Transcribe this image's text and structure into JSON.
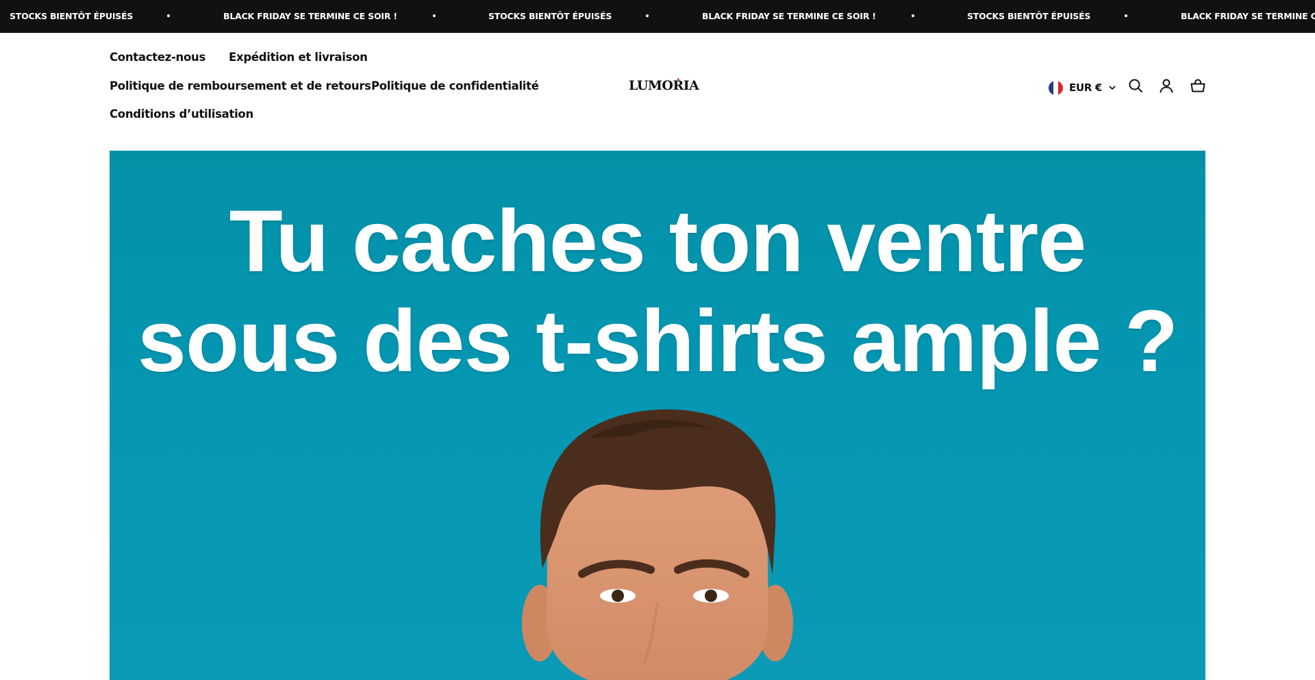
{
  "announcement": {
    "items": [
      "STOCKS BIENTÔT ÉPUISÉS",
      "BLACK FRIDAY SE TERMINE CE SOIR !",
      "STOCKS BIENTÔT ÉPUISÉS",
      "BLACK FRIDAY SE TERMINE CE SOIR !",
      "STOCKS BIENTÔT ÉPUISÉS",
      "BLACK FRIDAY SE TERMINE CE SOIR !"
    ],
    "background": "#111111",
    "text_color": "#ffffff"
  },
  "nav": {
    "contact": "Contactez-nous",
    "shipping": "Expédition et livraison",
    "refunds": "Politique de remboursement et de retours",
    "privacy": "Politique de confidentialité",
    "terms": "Conditions d’utilisation"
  },
  "brand": {
    "logo_text": "LUMORIA",
    "accent": "#c0392b"
  },
  "utility": {
    "currency": "EUR €",
    "flag_colors": [
      "#1f3c8c",
      "#ffffff",
      "#d62828"
    ],
    "icons": [
      "search-icon",
      "account-icon",
      "cart-icon"
    ]
  },
  "hero": {
    "headline_line1": "Tu caches ton ventre",
    "headline_line2": "sous des t-shirts ample ?",
    "background": "#0597b3"
  }
}
